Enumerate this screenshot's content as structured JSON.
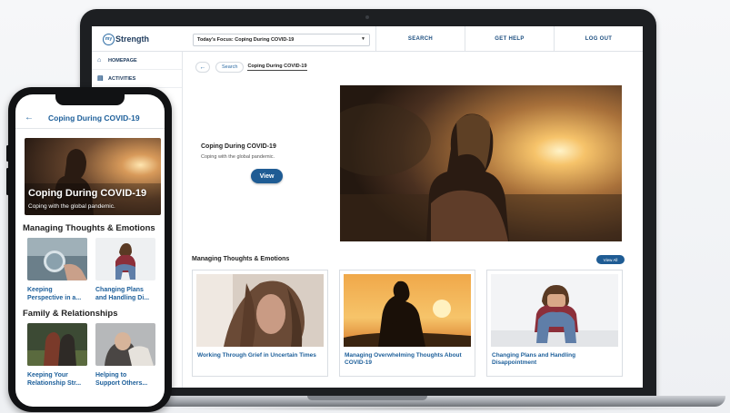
{
  "laptop": {
    "logo": {
      "badge": "my",
      "text": "Strength"
    },
    "focus_select": {
      "value": "Today's Focus: Coping During COVID-19"
    },
    "nav": {
      "search": "SEARCH",
      "get_help": "GET HELP",
      "log_out": "LOG OUT"
    },
    "sidebar": {
      "items": [
        {
          "label": "HOMEPAGE",
          "icon": "home-icon"
        },
        {
          "label": "ACTIVITIES",
          "icon": "activities-icon"
        }
      ]
    },
    "breadcrumb": {
      "back": "←",
      "search": "Search",
      "current": "Coping During COVID-19"
    },
    "hero": {
      "title": "Coping During COVID-19",
      "subtitle": "Coping with the global pandemic.",
      "button": "View"
    },
    "section": {
      "title": "Managing Thoughts & Emotions",
      "view_all": "View All"
    },
    "cards": [
      {
        "label": "Working Through Grief in Uncertain Times"
      },
      {
        "label": "Managing Overwhelming Thoughts About COVID-19"
      },
      {
        "label": "Changing Plans and Handling Disappointment"
      }
    ]
  },
  "phone": {
    "header": {
      "back": "←",
      "title": "Coping During COVID-19"
    },
    "hero": {
      "title": "Coping During COVID-19",
      "subtitle": "Coping with the global pandemic."
    },
    "sections": [
      {
        "title": "Managing Thoughts & Emotions",
        "items": [
          {
            "line1": "Keeping",
            "line2": "Perspective in a..."
          },
          {
            "line1": "Changing Plans",
            "line2": "and Handling Di..."
          }
        ]
      },
      {
        "title": "Family & Relationships",
        "items": [
          {
            "line1": "Keeping Your",
            "line2": "Relationship Str..."
          },
          {
            "line1": "Helping to",
            "line2": "Support Others..."
          }
        ]
      }
    ]
  },
  "colors": {
    "brand_blue": "#1f5c94",
    "link_blue": "#1d5f9a",
    "device_black": "#1d1f22"
  }
}
